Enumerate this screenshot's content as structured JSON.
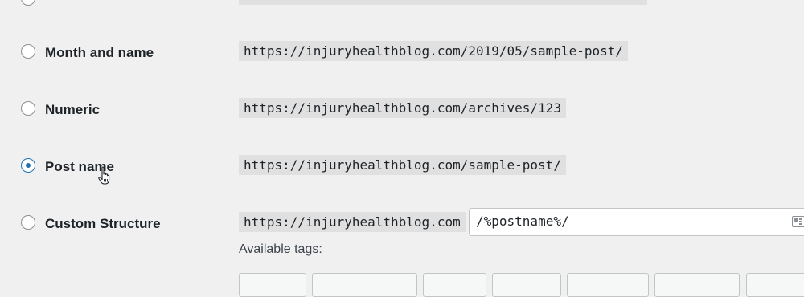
{
  "options": [
    {
      "label": "Month and name",
      "example": "https://injuryhealthblog.com/2019/05/sample-post/",
      "checked": false
    },
    {
      "label": "Numeric",
      "example": "https://injuryhealthblog.com/archives/123",
      "checked": false
    },
    {
      "label": "Post name",
      "example": "https://injuryhealthblog.com/sample-post/",
      "checked": true
    },
    {
      "label": "Custom Structure",
      "example": "https://injuryhealthblog.com",
      "checked": false
    }
  ],
  "custom_structure": {
    "value": "/%postname%/"
  },
  "available_tags_label": "Available tags:",
  "colors": {
    "accent": "#2271b1",
    "background": "#f0f0f1"
  }
}
